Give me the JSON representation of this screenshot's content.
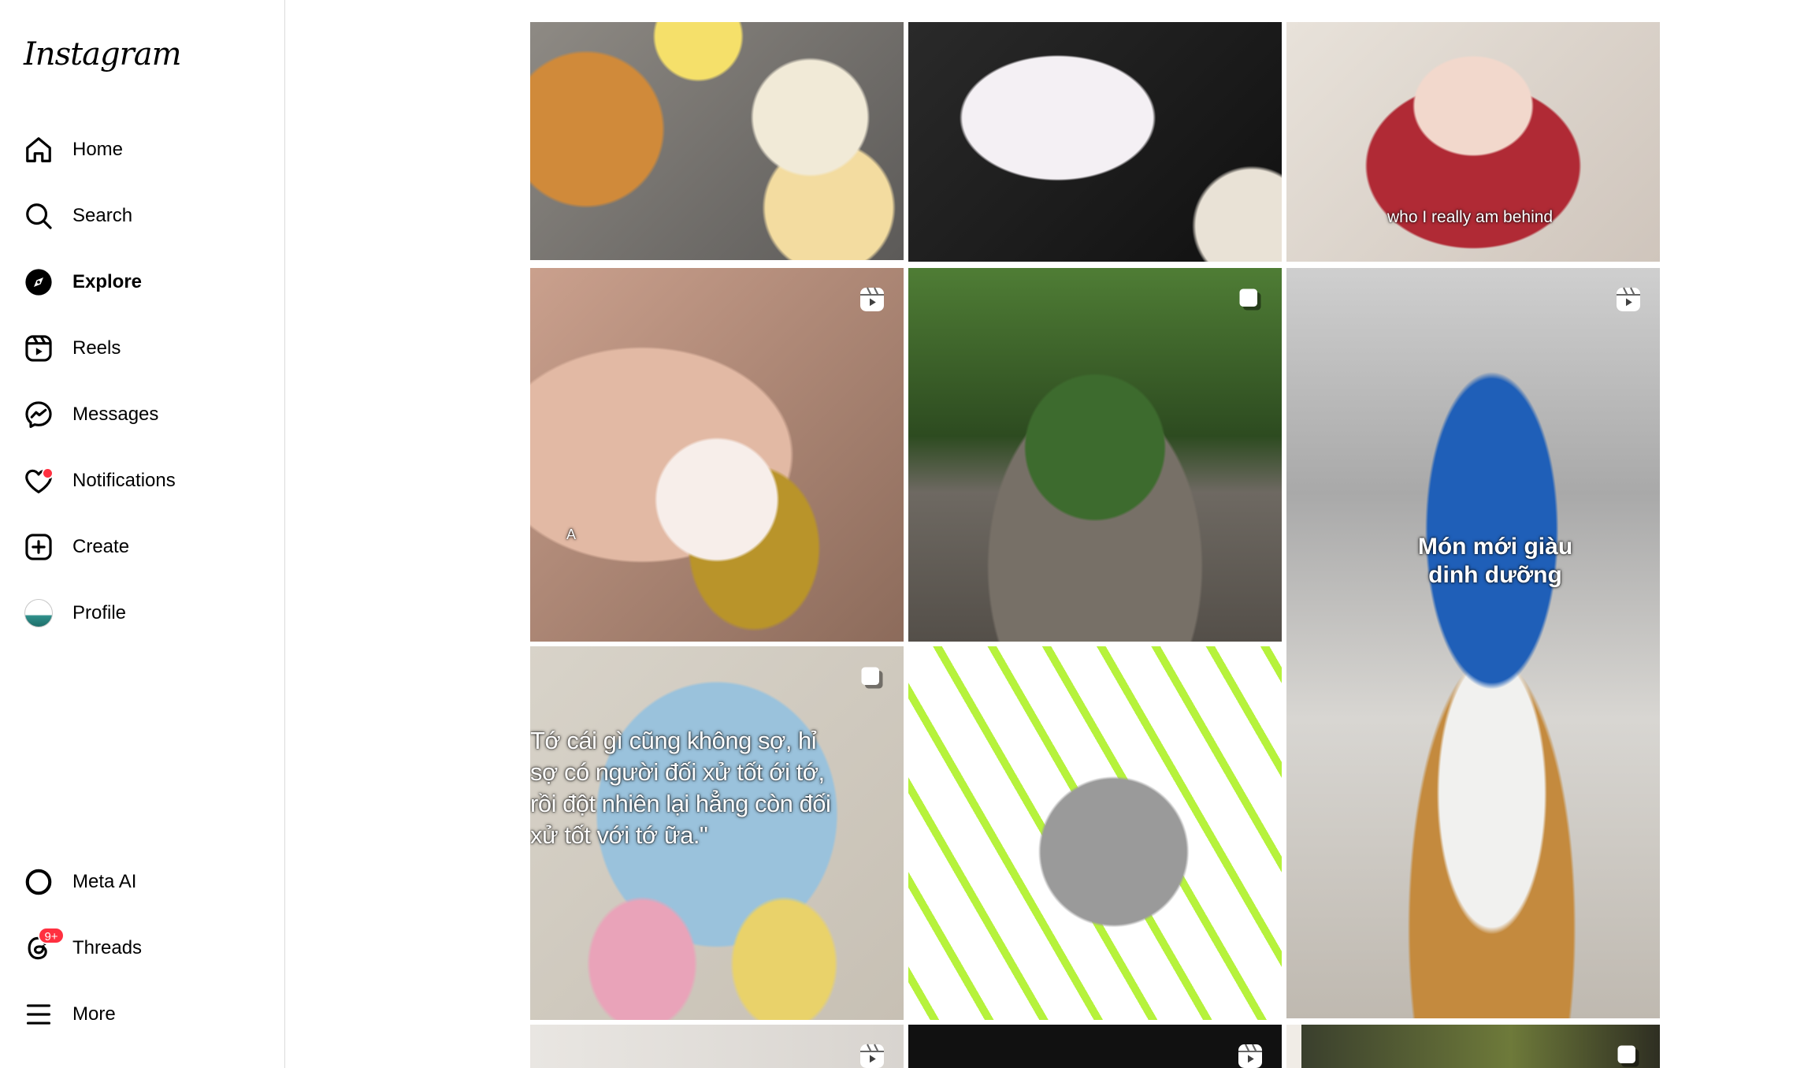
{
  "app": {
    "logo_text": "Instagram"
  },
  "sidebar": {
    "items": [
      {
        "label": "Home",
        "icon": "home-icon"
      },
      {
        "label": "Search",
        "icon": "search-icon"
      },
      {
        "label": "Explore",
        "icon": "explore-compass-icon",
        "active": true
      },
      {
        "label": "Reels",
        "icon": "reels-icon"
      },
      {
        "label": "Messages",
        "icon": "messenger-icon"
      },
      {
        "label": "Notifications",
        "icon": "heart-icon",
        "has_dot": true
      },
      {
        "label": "Create",
        "icon": "plus-square-icon"
      },
      {
        "label": "Profile",
        "icon": "avatar"
      }
    ],
    "bottom_items": [
      {
        "label": "Meta AI",
        "icon": "meta-ai-ring-icon"
      },
      {
        "label": "Threads",
        "icon": "threads-icon",
        "badge": "9+"
      },
      {
        "label": "More",
        "icon": "hamburger-menu-icon"
      }
    ]
  },
  "explore_grid": {
    "posts": [
      {
        "type": "image",
        "overlay": ""
      },
      {
        "type": "image",
        "overlay": ""
      },
      {
        "type": "image",
        "overlay": "who I really am behind"
      },
      {
        "type": "reel",
        "overlay": "A"
      },
      {
        "type": "carousel",
        "overlay": ""
      },
      {
        "type": "reel",
        "overlay": "Món mới giàu dinh dưỡng"
      },
      {
        "type": "carousel",
        "overlay": "Tớ cái gì cũng không sợ, hỉ sợ có người đối xử tốt ới tớ, rồi đột nhiên lại hẳng còn đối xử tốt với tớ ữa.\""
      },
      {
        "type": "image",
        "overlay": ""
      },
      {
        "type": "image",
        "overlay": ""
      },
      {
        "type": "reel",
        "overlay": ""
      },
      {
        "type": "reel",
        "overlay": ""
      },
      {
        "type": "carousel",
        "overlay": ""
      }
    ]
  },
  "colors": {
    "border": "#dbdbdb",
    "notification_red": "#ff3040",
    "text": "#000000"
  }
}
